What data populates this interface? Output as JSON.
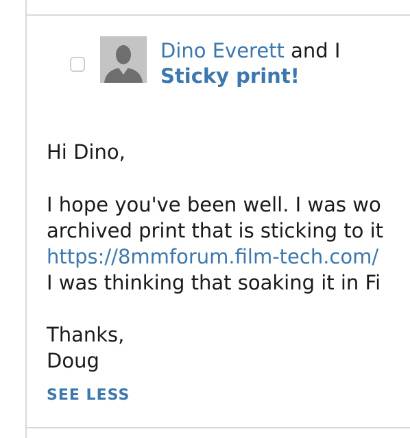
{
  "message": {
    "sender_name": "Dino Everett",
    "recipients_suffix": " and I",
    "subject": "Sticky print!",
    "body": {
      "greeting": "Hi Dino,",
      "line1": "I hope you've been well. I was wo",
      "line2": "archived print that is sticking to it",
      "link": "https://8mmforum.film-tech.com/",
      "line4": "I was thinking that soaking it in Fi",
      "signoff": "Thanks,",
      "signature": "Doug"
    },
    "toggle_label": "SEE LESS"
  },
  "icons": {
    "checkbox": "checkbox-unchecked",
    "avatar": "default-user-avatar"
  },
  "colors": {
    "link": "#3c77ad",
    "text": "#1a1a1a",
    "divider": "#d9d9d9",
    "avatar_bg": "#c4c4c4"
  }
}
